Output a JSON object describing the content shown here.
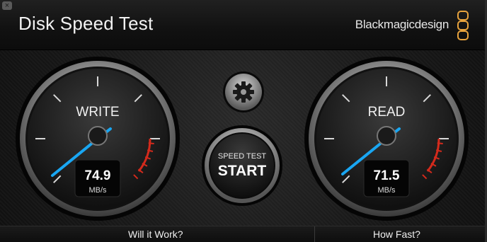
{
  "window": {
    "title": "Disk Speed Test",
    "brand": "Blackmagicdesign",
    "brand_color": "#e8a33d"
  },
  "write_gauge": {
    "label": "WRITE",
    "value": "74.9",
    "unit": "MB/s"
  },
  "read_gauge": {
    "label": "READ",
    "value": "71.5",
    "unit": "MB/s"
  },
  "start_button": {
    "line1": "SPEED TEST",
    "line2": "START"
  },
  "settings": {
    "icon": "gear-icon"
  },
  "bottom_bar": {
    "left_label": "Will it Work?",
    "right_label": "How Fast?"
  },
  "colors": {
    "needle": "#19a6f2",
    "redzone": "#d42a1c"
  }
}
